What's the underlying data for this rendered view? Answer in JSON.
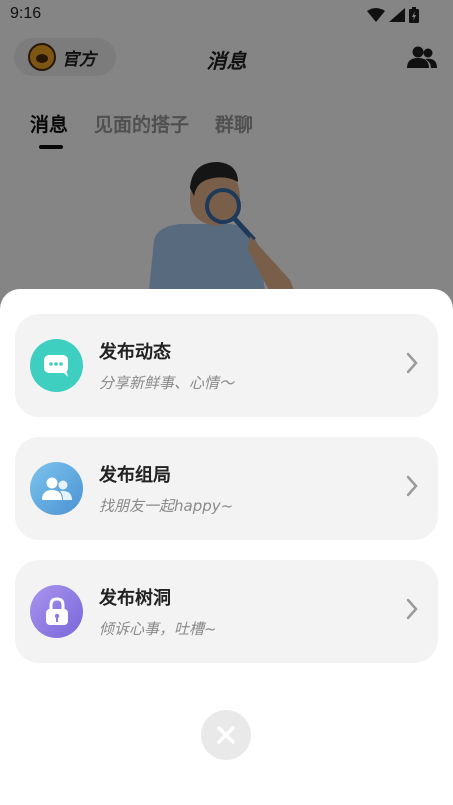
{
  "status_bar": {
    "time": "9:16"
  },
  "header": {
    "official_label": "官方",
    "title": "消息"
  },
  "tabs": [
    {
      "label": "消息",
      "active": true
    },
    {
      "label": "见面的搭子",
      "active": false
    },
    {
      "label": "群聊",
      "active": false
    }
  ],
  "sheet": {
    "options": [
      {
        "title": "发布动态",
        "subtitle": "分享新鲜事、心情～",
        "icon": "chat-bubble-icon",
        "color": "#3ecfc1"
      },
      {
        "title": "发布组局",
        "subtitle": "找朋友一起happy~",
        "icon": "group-people-icon",
        "color": "#5aa5e0"
      },
      {
        "title": "发布树洞",
        "subtitle": "倾诉心事，吐槽~",
        "icon": "lock-icon",
        "color": "#8c7ae6"
      }
    ],
    "close_icon": "close-icon"
  }
}
